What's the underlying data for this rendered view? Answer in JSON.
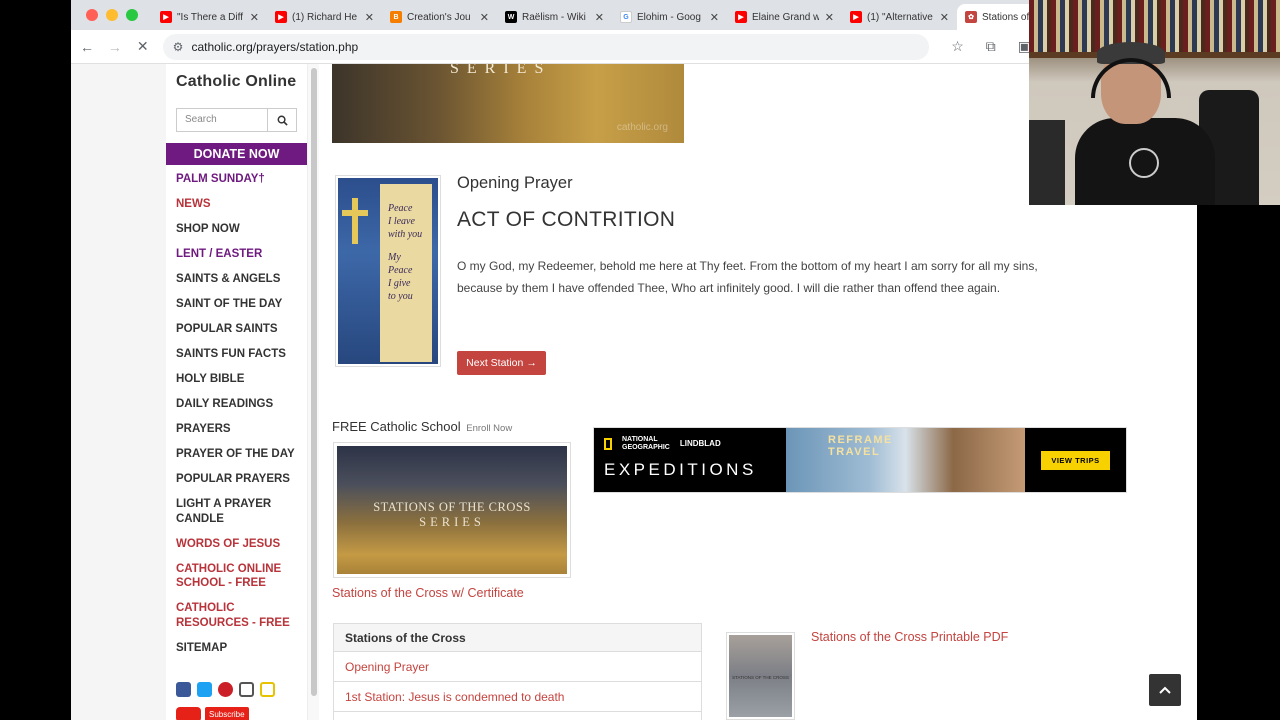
{
  "browser": {
    "tabs": [
      {
        "title": "\"Is There a Diff",
        "favicon": "yt"
      },
      {
        "title": "(1) Richard He",
        "favicon": "yt"
      },
      {
        "title": "Creation's Jou",
        "favicon": "blogger"
      },
      {
        "title": "Raëlism - Wiki",
        "favicon": "wiki"
      },
      {
        "title": "Elohim - Goog",
        "favicon": "google"
      },
      {
        "title": "Elaine Grand w",
        "favicon": "yt"
      },
      {
        "title": "(1) \"Alternative",
        "favicon": "yt"
      },
      {
        "title": "Stations of the",
        "favicon": "catholic",
        "active": true
      }
    ],
    "url": "catholic.org/prayers/station.php"
  },
  "sidebar": {
    "brand": "Catholic Online",
    "search_placeholder": "Search",
    "donate_label": "DONATE NOW",
    "items": [
      {
        "label": "PALM SUNDAY†",
        "color": "purple"
      },
      {
        "label": "NEWS",
        "color": "red"
      },
      {
        "label": "SHOP NOW",
        "color": "dark"
      },
      {
        "label": "LENT / EASTER",
        "color": "purple"
      },
      {
        "label": "SAINTS & ANGELS",
        "color": "dark"
      },
      {
        "label": "SAINT OF THE DAY",
        "color": "dark"
      },
      {
        "label": "POPULAR SAINTS",
        "color": "dark"
      },
      {
        "label": "SAINTS FUN FACTS",
        "color": "dark"
      },
      {
        "label": "HOLY BIBLE",
        "color": "dark"
      },
      {
        "label": "DAILY READINGS",
        "color": "dark"
      },
      {
        "label": "PRAYERS",
        "color": "dark"
      },
      {
        "label": "PRAYER OF THE DAY",
        "color": "dark"
      },
      {
        "label": "POPULAR PRAYERS",
        "color": "dark"
      },
      {
        "label": "LIGHT A PRAYER CANDLE",
        "color": "dark"
      },
      {
        "label": "WORDS OF JESUS",
        "color": "red"
      },
      {
        "label": "CATHOLIC ONLINE SCHOOL - Free",
        "color": "red"
      },
      {
        "label": "CATHOLIC RESOURCES - Free",
        "color": "red"
      },
      {
        "label": "SITEMAP",
        "color": "dark"
      }
    ],
    "social": [
      "facebook-icon",
      "twitter-icon",
      "pinterest-icon",
      "instagram-icon",
      "email-icon"
    ],
    "youtube_subscribe": "Subscribe"
  },
  "main": {
    "hero_text": "SERIES",
    "hero_watermark": "catholic.org",
    "prayer_image_lines": [
      "Peace",
      "I leave",
      "with you",
      "",
      "My",
      "Peace",
      "I give",
      "to you"
    ],
    "section_title": "Opening Prayer",
    "prayer_title": "ACT OF CONTRITION",
    "prayer_body": "O my God, my Redeemer, behold me here at Thy feet. From the bottom of my heart I am sorry for all my sins, because by them I have offended Thee, Who art infinitely good. I will die rather than offend thee again.",
    "next_button": "Next Station",
    "school_heading": "FREE Catholic School",
    "enroll_now": "Enroll Now",
    "course_image_text_1": "STATIONS OF THE CROSS",
    "course_image_text_2": "SERIES",
    "course_link": "Stations of the Cross w/ Certificate",
    "ad": {
      "brand_line_1": "NATIONAL",
      "brand_line_2": "GEOGRAPHIC",
      "partner": "LINDBLAD",
      "headline": "EXPEDITIONS",
      "tagline_1": "REFRAME",
      "tagline_2": "TRAVEL",
      "cta": "VIEW TRIPS"
    },
    "stations_box": {
      "heading": "Stations of the Cross",
      "rows": [
        "Opening Prayer",
        "1st Station: Jesus is condemned to death"
      ]
    },
    "pdf_thumb_text": "STATIONS OF THE CROSS",
    "pdf_link": "Stations of the Cross Printable PDF"
  },
  "colors": {
    "brand_purple": "#6f1a80",
    "link_red": "#c4443f"
  }
}
